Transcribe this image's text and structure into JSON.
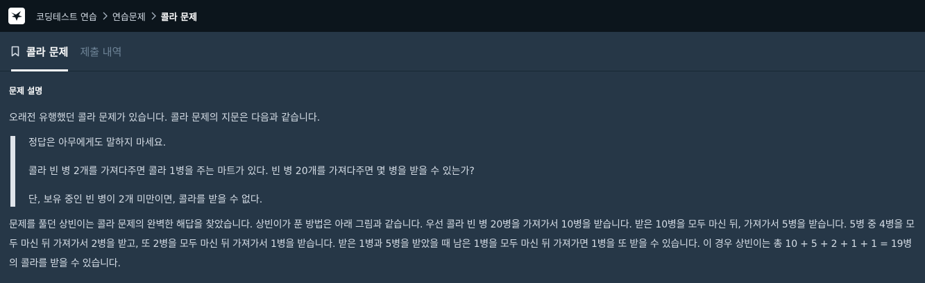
{
  "breadcrumb": {
    "items": [
      "코딩테스트 연습",
      "연습문제"
    ],
    "current": "콜라 문제"
  },
  "tabs": [
    {
      "label": "콜라 문제",
      "active": true
    },
    {
      "label": "제출 내역",
      "active": false
    }
  ],
  "problem": {
    "section_title": "문제 설명",
    "intro": "오래전 유행했던 콜라 문제가 있습니다. 콜라 문제의 지문은 다음과 같습니다.",
    "quote": [
      "정답은 아무에게도 말하지 마세요.",
      "콜라 빈 병 2개를 가져다주면 콜라 1병을 주는 마트가 있다. 빈 병 20개를 가져다주면 몇 병을 받을 수 있는가?",
      "단, 보유 중인 빈 병이 2개 미만이면, 콜라를 받을 수 없다."
    ],
    "body": "문제를 풀던 상빈이는 콜라 문제의 완벽한 해답을 찾았습니다. 상빈이가 푼 방법은 아래 그림과 같습니다. 우선 콜라 빈 병 20병을 가져가서 10병을 받습니다. 받은 10병을 모두 마신 뒤, 가져가서 5병을 받습니다. 5병 중 4병을 모두 마신 뒤 가져가서 2병을 받고, 또 2병을 모두 마신 뒤 가져가서 1병을 받습니다. 받은 1병과 5병을 받았을 때 남은 1병을 모두 마신 뒤 가져가면 1병을 또 받을 수 있습니다. 이 경우 상빈이는 총 10 + 5 + 2 + 1 + 1 = 19병의 콜라를 받을 수 있습니다."
  },
  "icons": {
    "logo": "programmers-logo-icon",
    "separator": "chevron-right-icon",
    "tab": "bookmark-icon"
  },
  "colors": {
    "background": "#263747",
    "topbar": "#0c151c",
    "text": "#d5dde6",
    "muted": "#6f8598",
    "active": "#ffffff"
  }
}
